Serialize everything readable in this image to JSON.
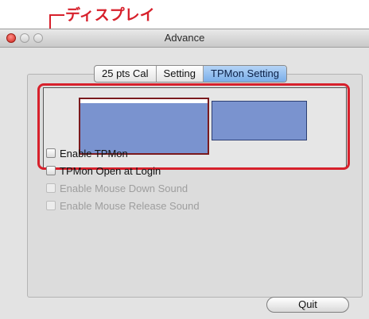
{
  "annotation": {
    "label": "ディスプレイ",
    "color": "#d7202b"
  },
  "window": {
    "title": "Advance"
  },
  "tabs": [
    {
      "label": "25 pts Cal",
      "active": false
    },
    {
      "label": "Setting",
      "active": false
    },
    {
      "label": "TPMon Setting",
      "active": true
    }
  ],
  "display_arrangement": {
    "screens": [
      {
        "name": "main-display",
        "has_menubar": true,
        "color": "#7a93cf"
      },
      {
        "name": "secondary-display",
        "has_menubar": false,
        "color": "#7a93cf"
      }
    ]
  },
  "options": [
    {
      "label": "Enable TPMon",
      "checked": false,
      "enabled": true
    },
    {
      "label": "TPMon Open at Login",
      "checked": false,
      "enabled": true
    },
    {
      "label": "Enable Mouse Down Sound",
      "checked": false,
      "enabled": false
    },
    {
      "label": "Enable Mouse Release Sound",
      "checked": false,
      "enabled": false
    }
  ],
  "buttons": {
    "quit": "Quit"
  },
  "colors": {
    "selected_tab": "#7aaee9",
    "highlight": "#d7202b"
  }
}
